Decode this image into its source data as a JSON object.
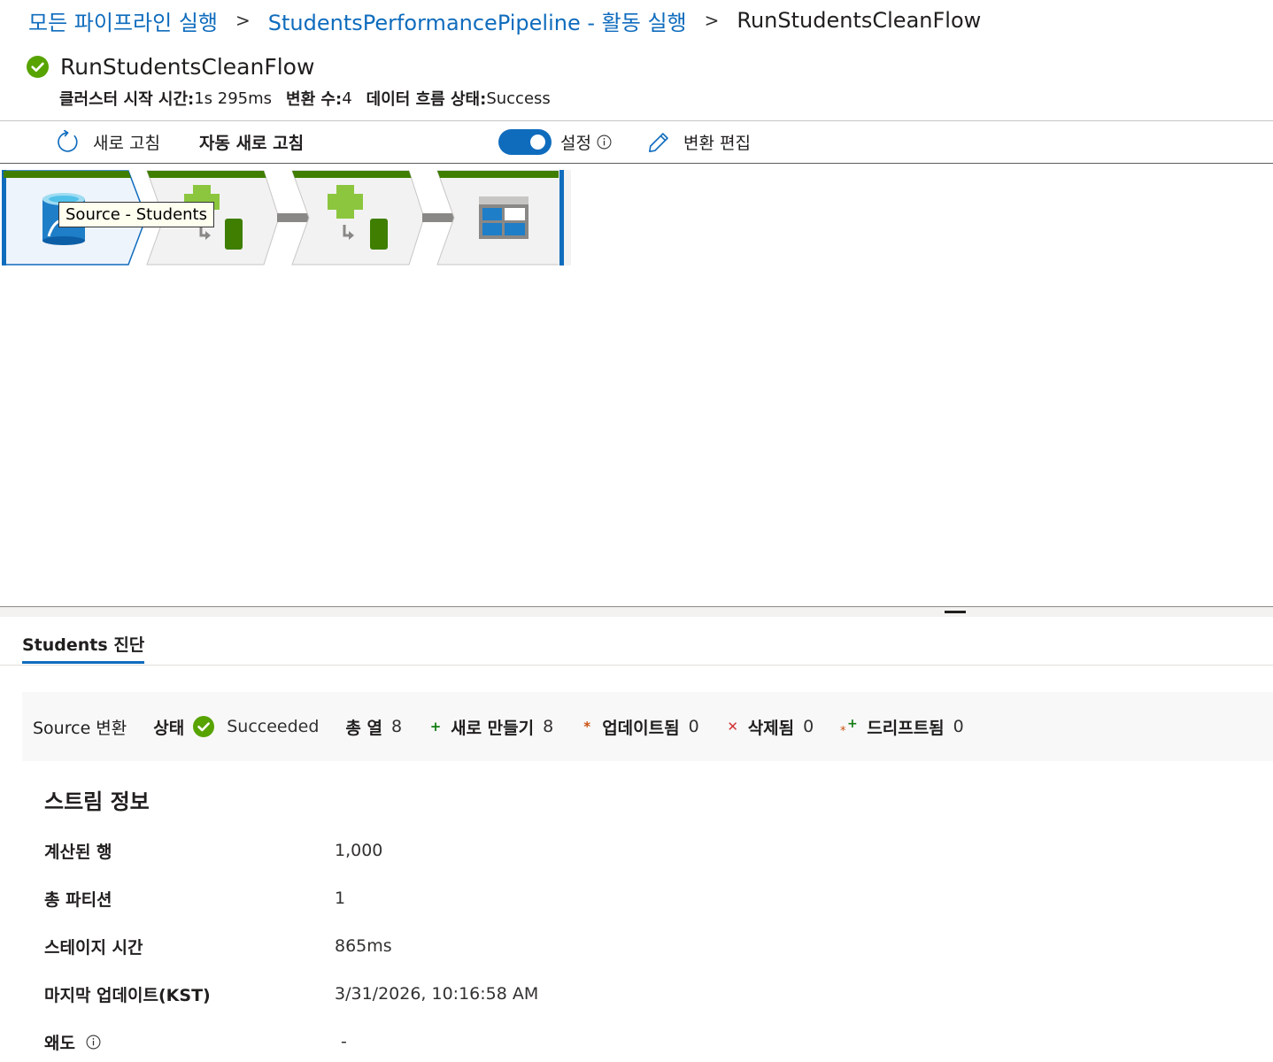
{
  "breadcrumb": {
    "items": [
      "모든 파이프라인 실행",
      "StudentsPerformancePipeline - 활동 실행"
    ],
    "separator": ">",
    "current": "RunStudentsCleanFlow"
  },
  "header": {
    "title": "RunStudentsCleanFlow",
    "status_icon": "success-check-icon",
    "cluster_start_label": "클러스터 시작 시간:",
    "cluster_start_value": "1s 295ms",
    "transform_count_label": "변환 수:",
    "transform_count_value": "4",
    "flow_status_label": "데이터 흐름 상태:",
    "flow_status_value": "Success"
  },
  "toolbar": {
    "refresh_label": "새로 고침",
    "auto_refresh_label": "자동 새로 고침",
    "settings_label": "설정",
    "settings_toggle_on": true,
    "edit_label": "변환 편집"
  },
  "flow": {
    "nodes": [
      {
        "kind": "source",
        "icon": "database-icon",
        "selected": true
      },
      {
        "kind": "transform",
        "icon": "derived-column-icon",
        "selected": false
      },
      {
        "kind": "transform",
        "icon": "derived-column-icon",
        "selected": false
      },
      {
        "kind": "sink",
        "icon": "table-sink-icon",
        "selected": false
      }
    ],
    "tooltip": "Source - Students"
  },
  "panel": {
    "tab_label": "Students 진단",
    "summary": {
      "transform_type": "Source 변환",
      "status_label": "상태",
      "status_value": "Succeeded",
      "total_cols_label": "총 열",
      "total_cols_value": "8",
      "new_label": "새로 만들기",
      "new_value": "8",
      "updated_label": "업데이트됨",
      "updated_value": "0",
      "deleted_label": "삭제됨",
      "deleted_value": "0",
      "drifted_label": "드리프트됨",
      "drifted_value": "0"
    },
    "stream_info": {
      "title": "스트림 정보",
      "rows": [
        {
          "label": "계산된 행",
          "value": "1,000"
        },
        {
          "label": "총 파티션",
          "value": "1"
        },
        {
          "label": "스테이지 시간",
          "value": "865ms"
        },
        {
          "label": "마지막 업데이트(KST)",
          "value": "3/31/2026, 10:16:58 AM"
        },
        {
          "label": "왜도",
          "value": "-"
        }
      ]
    }
  },
  "colors": {
    "accent": "#0f6cbd",
    "success": "#57a300",
    "node_header": "#3f7e00",
    "node_fill": "#f2f2f2",
    "selected_fill": "#eef4fc"
  }
}
